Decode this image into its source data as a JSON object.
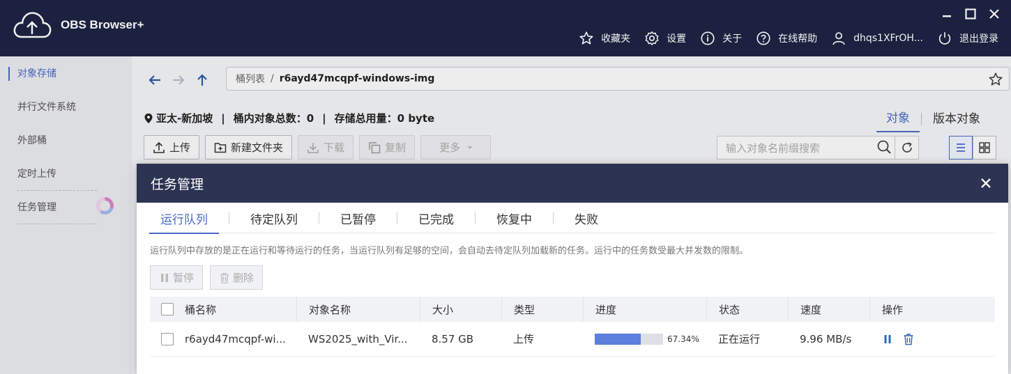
{
  "app": {
    "title": "OBS Browser+",
    "nav": [
      {
        "label": "收藏夹",
        "icon": "star-icon"
      },
      {
        "label": "设置",
        "icon": "gear-icon"
      },
      {
        "label": "关于",
        "icon": "info-icon"
      },
      {
        "label": "在线帮助",
        "icon": "help-icon"
      },
      {
        "label": "dhqs1XFrOH...",
        "icon": "user-icon"
      },
      {
        "label": "退出登录",
        "icon": "power-icon"
      }
    ]
  },
  "sidebar": {
    "items": [
      {
        "label": "对象存储"
      },
      {
        "label": "并行文件系统"
      },
      {
        "label": "外部桶"
      },
      {
        "label": "定时上传"
      },
      {
        "label": "任务管理"
      }
    ]
  },
  "path": {
    "root": "桶列表",
    "sep": "/",
    "current": "r6ayd47mcqpf-windows-img"
  },
  "info": {
    "region": "亚太-新加坡",
    "sep": "|",
    "objects_label": "桶内对象总数：0",
    "storage_label": "存储总用量：0 byte"
  },
  "view_tabs": [
    "对象",
    "版本对象"
  ],
  "toolbar": {
    "upload": "上传",
    "new_folder": "新建文件夹",
    "download": "下载",
    "copy": "复制",
    "more": "更多"
  },
  "search": {
    "placeholder": "输入对象名前缀搜索"
  },
  "dialog": {
    "title": "任务管理",
    "tabs": [
      "运行队列",
      "待定队列",
      "已暂停",
      "已完成",
      "恢复中",
      "失败"
    ],
    "description": "运行队列中存放的是正在运行和等待运行的任务，当运行队列有足够的空间，会自动去待定队列加载新的任务。运行中的任务数受最大并发数的限制。",
    "pause_label": "暂停",
    "delete_label": "删除",
    "columns": [
      "桶名称",
      "对象名称",
      "大小",
      "类型",
      "进度",
      "状态",
      "速度",
      "操作"
    ],
    "rows": [
      {
        "bucket": "r6ayd47mcqpf-wi...",
        "object": "WS2025_with_Vir...",
        "size": "8.57 GB",
        "type": "上传",
        "progress": 0.6734,
        "progress_text": "67.34%",
        "status": "正在运行",
        "speed": "9.96 MB/s"
      }
    ]
  },
  "colors": {
    "header": "#1d2343",
    "accent": "#4a69c7",
    "dialog_header": "#2d3452",
    "progress": "#5a7fdc"
  }
}
